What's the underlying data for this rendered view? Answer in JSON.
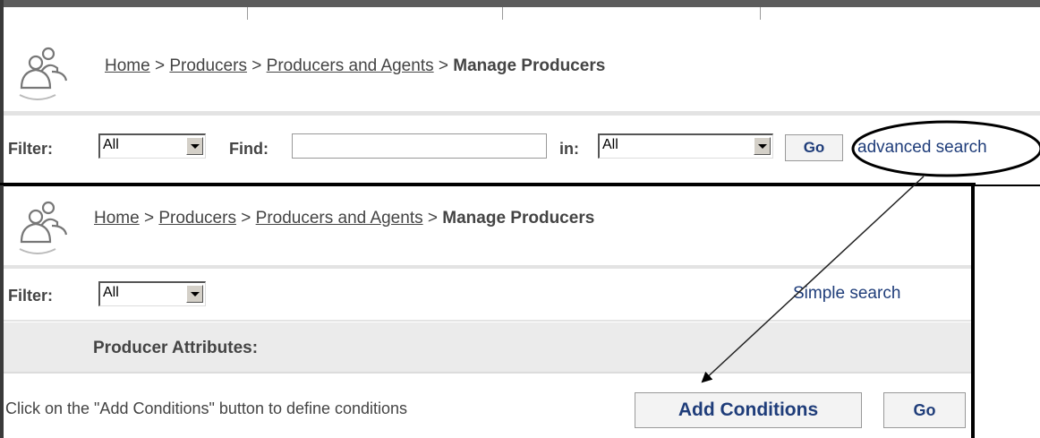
{
  "simple_search": {
    "breadcrumb": {
      "home": "Home",
      "producers": "Producers",
      "producers_and_agents": "Producers and Agents",
      "current": "Manage Producers",
      "separator": ">"
    },
    "filter_label": "Filter:",
    "filter_value": "All",
    "find_label": "Find:",
    "find_value": "",
    "in_label": "in:",
    "in_value": "All",
    "go_label": "Go",
    "advanced_search_link": "advanced search"
  },
  "advanced_search": {
    "breadcrumb": {
      "home": "Home",
      "producers": "Producers",
      "producers_and_agents": "Producers and Agents",
      "current": "Manage Producers",
      "separator": ">"
    },
    "filter_label": "Filter:",
    "filter_value": "All",
    "simple_search_link": "Simple search",
    "attributes_heading": "Producer Attributes:",
    "instruction": "Click on the \"Add Conditions\" button to define conditions",
    "add_conditions_label": "Add Conditions",
    "go_label": "Go"
  },
  "icons": {
    "producers": "people-icon"
  },
  "colors": {
    "link": "#1f3d7a",
    "band": "#ebebeb",
    "border": "#000000"
  }
}
